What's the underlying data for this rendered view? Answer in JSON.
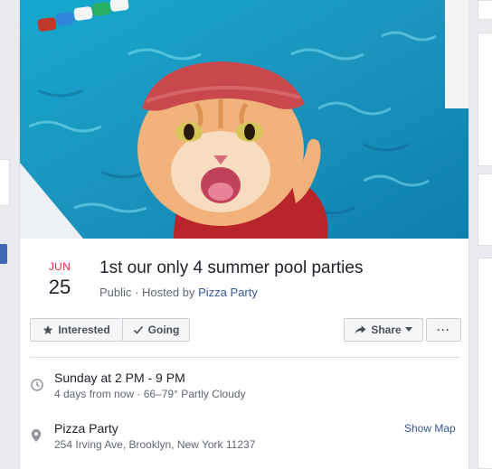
{
  "event": {
    "month": "JUN",
    "day": "25",
    "title": "1st our only 4 summer pool parties",
    "privacy": "Public",
    "hosted_by_prefix": " · Hosted by ",
    "host": "Pizza Party"
  },
  "actions": {
    "interested": "Interested",
    "going": "Going",
    "share": "Share",
    "more": "···"
  },
  "details": {
    "time_main": "Sunday at 2 PM - 9 PM",
    "time_sub": "4 days from now · 66–79° Partly Cloudy",
    "location_name": "Pizza Party",
    "location_address": "254 Irving Ave, Brooklyn, New York 11237",
    "show_map": "Show Map"
  },
  "colors": {
    "month_red": "#f02849",
    "link_blue": "#385898",
    "pool_blue": "#1fa3c7",
    "swim_cap": "#c8484c"
  },
  "icons": [
    "star-icon",
    "check-icon",
    "share-arrow-icon",
    "caret-down-icon",
    "clock-icon",
    "map-pin-icon"
  ]
}
